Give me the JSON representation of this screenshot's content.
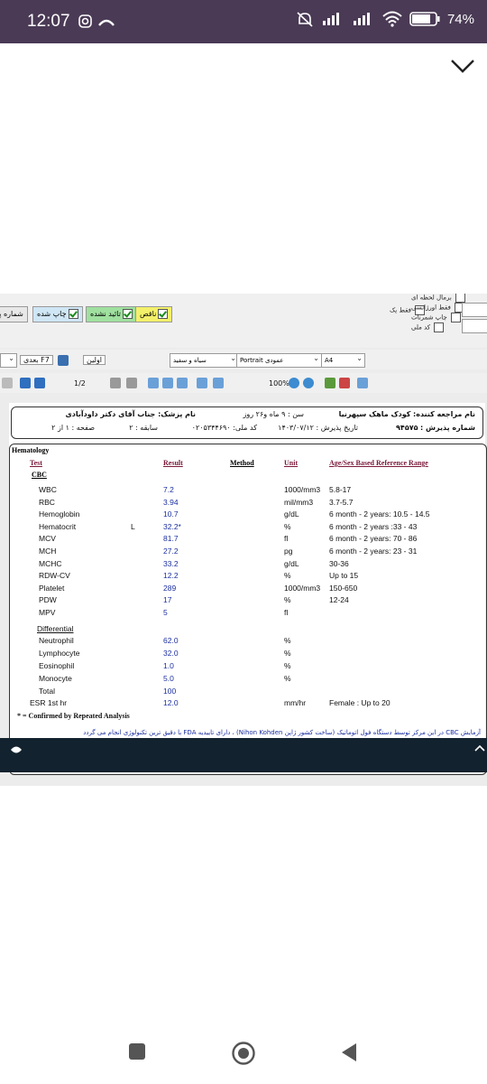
{
  "status_bar": {
    "time": "12:07",
    "battery": "74%"
  },
  "toolbar": {
    "chips": {
      "printed": "چاپ شده",
      "confirmed": "تائید نشده",
      "incomplete": "ناقص",
      "acceptance_number": "شماره پذ"
    },
    "options": {
      "urgent": "برمال لحظه ای",
      "emergency_only": "فقط اورژانسی",
      "print_stamps": "چاپ شمرنات",
      "national_code": "کد ملی",
      "only_one": "فقط یک"
    },
    "paper": "A4",
    "orientation": "Portrait عمودی",
    "color_mode": "سیاه و سفید",
    "nav_first": "اولین",
    "nav_next": "بعدی F7",
    "page": "1/2",
    "zoom": "100%"
  },
  "report_header": {
    "patient_label": "نام مراجعه کننده:",
    "patient_name": "کودک ماهک سپهرنیا",
    "age": "سن : ۹ ماه و۲۶ روز",
    "doctor": "نام پزشک: جناب آقای دکتر داودآبادی",
    "acceptance_label": "شماره پذیرش :",
    "acceptance_number": "۹۴۵۷۵",
    "date": "تاریخ پذیرش : ۱۴۰۳/۰۷/۱۲",
    "national_id": "کد ملی: ۰۲۰۵۳۴۴۶۹۰",
    "history": "سابقه : ۲",
    "page": "صفحه : ۱ از ۲"
  },
  "report": {
    "section": "Hematology",
    "columns": {
      "test": "Test",
      "result": "Result",
      "method": "Method",
      "unit": "Unit",
      "range": "Age/Sex Based Reference Range"
    },
    "group_cbc": "CBC",
    "group_diff": "Differential",
    "rows": [
      {
        "test": "WBC",
        "flag": "",
        "result": "7.2",
        "unit": "1000/mm3",
        "range": "5.8-17"
      },
      {
        "test": "RBC",
        "flag": "",
        "result": "3.94",
        "unit": "mil/mm3",
        "range": "3.7-5.7"
      },
      {
        "test": "Hemoglobin",
        "flag": "",
        "result": "10.7",
        "unit": "g/dL",
        "range": "6 month - 2 years: 10.5 - 14.5"
      },
      {
        "test": "Hematocrit",
        "flag": "L",
        "result": "32.2*",
        "unit": "%",
        "range": "6 month - 2 years :33 - 43"
      },
      {
        "test": "MCV",
        "flag": "",
        "result": "81.7",
        "unit": "fl",
        "range": "6 month - 2 years: 70 - 86"
      },
      {
        "test": "MCH",
        "flag": "",
        "result": "27.2",
        "unit": "pg",
        "range": "6 month - 2 years: 23 - 31"
      },
      {
        "test": "MCHC",
        "flag": "",
        "result": "33.2",
        "unit": "g/dL",
        "range": "30-36"
      },
      {
        "test": "RDW-CV",
        "flag": "",
        "result": "12.2",
        "unit": "%",
        "range": "Up to 15"
      },
      {
        "test": "Platelet",
        "flag": "",
        "result": "289",
        "unit": "1000/mm3",
        "range": "150-650"
      },
      {
        "test": "PDW",
        "flag": "",
        "result": "17",
        "unit": "%",
        "range": "12-24"
      },
      {
        "test": "MPV",
        "flag": "",
        "result": "5",
        "unit": "fl",
        "range": ""
      }
    ],
    "diff_rows": [
      {
        "test": "Neutrophil",
        "result": "62.0",
        "unit": "%"
      },
      {
        "test": "Lymphocyte",
        "result": "32.0",
        "unit": "%"
      },
      {
        "test": "Eosinophil",
        "result": "1.0",
        "unit": "%"
      },
      {
        "test": "Monocyte",
        "result": "5.0",
        "unit": "%"
      },
      {
        "test": "Total",
        "result": "100",
        "unit": ""
      }
    ],
    "esr": {
      "test": "ESR 1st hr",
      "result": "12.0",
      "unit": "mm/hr",
      "range": "Female : Up to 20"
    },
    "footnote": "* = Confirmed by Repeated Analysis",
    "disclaimer": "آزمایش CBC در این مرکز توسط دستگاه فول اتوماتیک (ساخت کشور ژاپن Nihon Kohden) ، دارای تاییدیه FDA با دقیق ترین تکنولوژی انجام می گردد"
  }
}
